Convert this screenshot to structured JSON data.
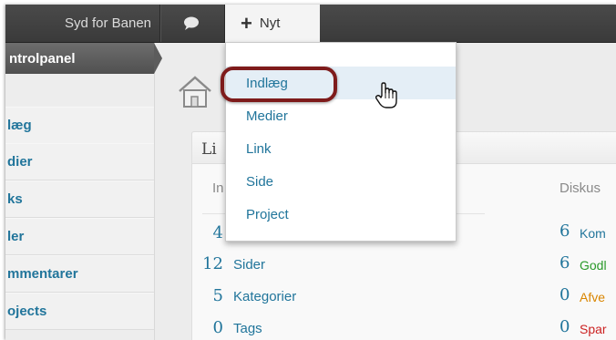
{
  "adminbar": {
    "site_name": "Syd for Banen",
    "comments_icon": "speech-bubble-icon",
    "new_icon": "plus-icon",
    "new_label": "Nyt"
  },
  "new_menu": {
    "items": [
      "Indlæg",
      "Medier",
      "Link",
      "Side",
      "Project"
    ],
    "active_index": 0
  },
  "sidebar": {
    "heading": "ntrolpanel",
    "items": [
      "læg",
      "dier",
      "ks",
      "ler",
      "mmentarer",
      "ojects"
    ]
  },
  "dashboard": {
    "home_icon": "house-icon",
    "box_title": "Li",
    "content_header": "In",
    "discussion_header": "Diskus",
    "rows": [
      {
        "count": "4",
        "label": ""
      },
      {
        "count": "12",
        "label": "Sider"
      },
      {
        "count": "5",
        "label": "Kategorier"
      },
      {
        "count": "0",
        "label": "Tags"
      }
    ],
    "discussion": [
      {
        "count": "6",
        "label": "Kom",
        "color": "#21759b"
      },
      {
        "count": "6",
        "label": "Godl",
        "color": "#2a9a2a"
      },
      {
        "count": "0",
        "label": "Afve",
        "color": "#d98500"
      },
      {
        "count": "0",
        "label": "Spar",
        "color": "#cc2222"
      }
    ]
  },
  "cursor_icon": "hand-pointer-icon"
}
